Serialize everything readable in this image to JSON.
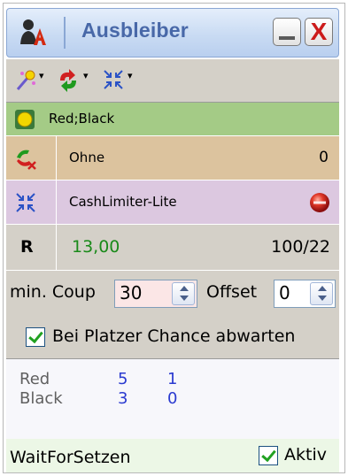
{
  "window": {
    "title": "Ausbleiber"
  },
  "titlebar": {
    "minimize_icon": "minimize-icon",
    "close_label": "X"
  },
  "toolbar": {
    "items": [
      {
        "icon": "magic-wand-icon",
        "dropdown": "▾"
      },
      {
        "icon": "swap-arrows-icon",
        "dropdown": "▾"
      },
      {
        "icon": "compress-icon",
        "dropdown": "▾"
      }
    ]
  },
  "rows": {
    "strategy": {
      "icon": "yellow-circle-icon",
      "text": "Red;Black",
      "color": "#a4cb86"
    },
    "progression": {
      "icon": "no-progression-icon",
      "text": "Ohne",
      "value": "0",
      "color": "#dcc39e"
    },
    "limiter": {
      "icon": "compress-icon",
      "text": "CashLimiter-Lite",
      "status_icon": "red-stop-icon",
      "color": "#dcc8e0"
    },
    "result": {
      "label": "R",
      "amount": "13,00",
      "ratio": "100/22",
      "amount_color": "#1a8a1a"
    }
  },
  "inputs": {
    "min_coup_label": "min. Coup",
    "min_coup_value": "30",
    "offset_label": "Offset",
    "offset_value": "0"
  },
  "options": {
    "wait_label": "Bei Platzer Chance abwarten",
    "wait_checked": true
  },
  "stats": {
    "rows": [
      {
        "name": "Red",
        "a": "5",
        "b": "1"
      },
      {
        "name": "Black",
        "a": "3",
        "b": "0"
      }
    ]
  },
  "status": {
    "text": "WaitForSetzen",
    "active_label": "Aktiv",
    "active_checked": true
  }
}
